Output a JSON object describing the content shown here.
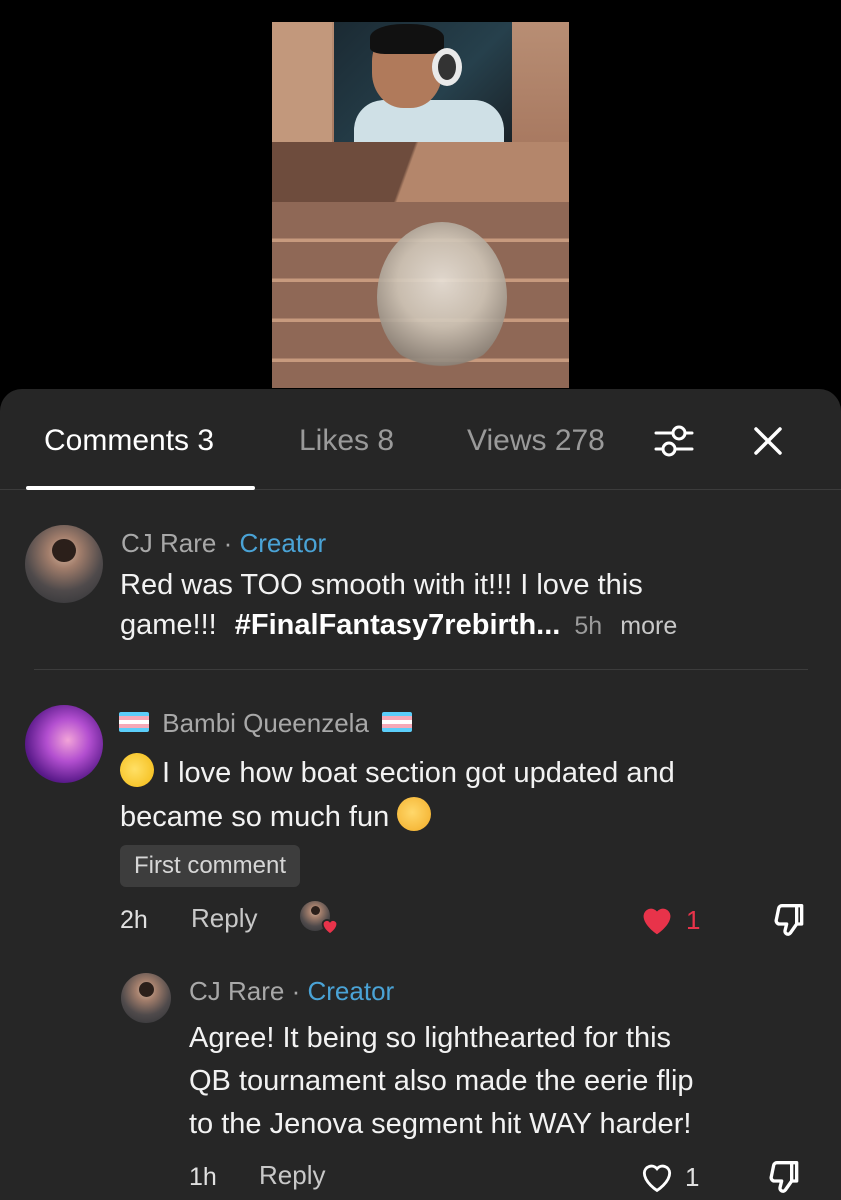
{
  "tabs": {
    "comments": "Comments 3",
    "likes": "Likes 8",
    "views": "Views 278"
  },
  "comments": [
    {
      "user": "CJ Rare",
      "separator": "·",
      "role": "Creator",
      "text": "Red was TOO smooth with it!!! I love this",
      "text_line2_prefix": "game!!!",
      "hashtag": "#FinalFantasy7rebirth",
      "ellipsis": "...",
      "time": "5h",
      "more": "more"
    },
    {
      "user": "Bambi Queenzela",
      "text_line1": "I love how boat section got updated and",
      "text_line2": "became so much fun",
      "badge": "First comment",
      "time": "2h",
      "reply": "Reply",
      "likes": "1",
      "replies": [
        {
          "user": "CJ Rare",
          "separator": "·",
          "role": "Creator",
          "text_line1": "Agree! It being so lighthearted for this",
          "text_line2": "QB tournament also made the eerie flip",
          "text_line3": "to the Jenova segment hit WAY harder!",
          "time": "1h",
          "reply": "Reply",
          "likes": "1"
        }
      ]
    }
  ],
  "colors": {
    "panel": "#262626",
    "creator": "#4aa3d6",
    "liked_heart": "#e8334a"
  },
  "icons": [
    "filter-icon",
    "close-icon",
    "heart-filled-icon",
    "heart-outline-icon",
    "dislike-icon"
  ]
}
